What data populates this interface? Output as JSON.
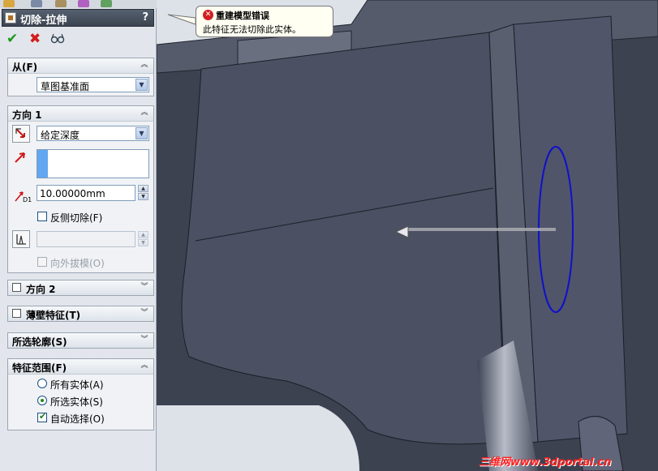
{
  "property_manager": {
    "title": "切除-拉伸",
    "help": "?",
    "actions": {
      "ok_icon": "checkmark-icon",
      "cancel_icon": "x-icon",
      "preview_icon": "glasses-icon"
    },
    "from": {
      "header": "从(F)",
      "start_condition": "草图基准面"
    },
    "direction1": {
      "header": "方向 1",
      "end_condition": "给定深度",
      "depth": "10.00000mm",
      "flip_side_label": "反侧切除(F)",
      "flip_side_checked": false,
      "draft_outward_label": "向外拔模(O)",
      "draft_outward_enabled": false
    },
    "direction2": {
      "header": "方向 2",
      "checked": false
    },
    "thin_feature": {
      "header": "薄壁特征(T)",
      "checked": false
    },
    "selected_contours": {
      "header": "所选轮廓(S)"
    },
    "feature_scope": {
      "header": "特征范围(F)",
      "options": [
        {
          "label": "所有实体(A)",
          "selected": false
        },
        {
          "label": "所选实体(S)",
          "selected": true
        }
      ],
      "auto_select_label": "自动选择(O)",
      "auto_select_checked": true
    }
  },
  "error_tooltip": {
    "title": "重建模型错误",
    "message": "此特征无法切除此实体。"
  },
  "watermark": "三维网www.3dportal.cn",
  "colors": {
    "accent": "#62a7f0",
    "error_red": "#d02020",
    "sketch_blue": "#1010cc",
    "model_gray": "#4c5164"
  }
}
